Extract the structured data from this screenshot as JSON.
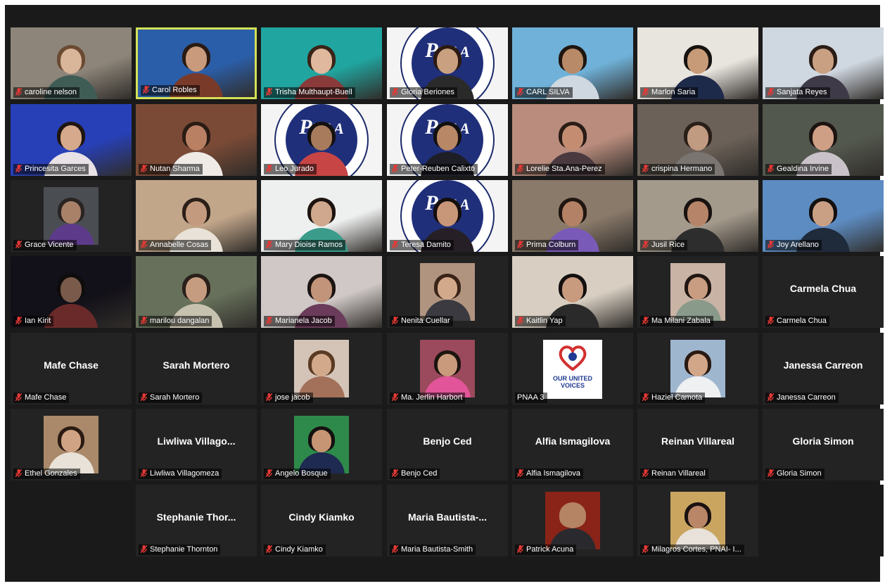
{
  "participants": [
    {
      "name": "caroline nelson",
      "display": "video",
      "bg": "#8d8579",
      "skin": "#d9b59a",
      "hair": "#6b4a32",
      "shirt": "#3f5c55"
    },
    {
      "name": "Carol Robles",
      "display": "video",
      "bg": "#2b5ea8",
      "skin": "#c99a7c",
      "hair": "#2a1a12",
      "shirt": "#7a3a2a",
      "active": true
    },
    {
      "name": "Trisha Multhaupt-Buell",
      "display": "video",
      "bg": "#21a5a0",
      "skin": "#e0b89d",
      "hair": "#3a2418",
      "shirt": "#8a3a3a"
    },
    {
      "name": "Gloria Beriones",
      "display": "pnaa",
      "skin": "#c9a080",
      "hair": "#2a1a12",
      "shirt": "#2a2a2a"
    },
    {
      "name": "CARL SILVA",
      "display": "video",
      "bg": "#6fb1d8",
      "skin": "#b88a68",
      "hair": "#1f1611",
      "shirt": "#cfd8e0"
    },
    {
      "name": "Marlon Saria",
      "display": "video",
      "bg": "#e8e4de",
      "skin": "#c79b78",
      "hair": "#161210",
      "shirt": "#1d2a4a"
    },
    {
      "name": "Sanjata Reyes",
      "display": "video",
      "bg": "#cfd7e0",
      "skin": "#caa083",
      "hair": "#2b1d16",
      "shirt": "#3e3a47"
    },
    {
      "name": "Princesita Garces",
      "display": "video",
      "bg": "#2740b8",
      "skin": "#d6a98c",
      "hair": "#20150f",
      "shirt": "#e8e2e6"
    },
    {
      "name": "Nutan Sharma",
      "display": "video",
      "bg": "#7a4a36",
      "skin": "#b98064",
      "hair": "#2a1c14",
      "shirt": "#efeae6"
    },
    {
      "name": "Leo Jurado",
      "display": "pnaa",
      "skin": "#a77b5c",
      "hair": "#151010",
      "shirt": "#c84545"
    },
    {
      "name": "Peter-Reuben Calixto",
      "display": "pnaa",
      "skin": "#b78766",
      "hair": "#121010",
      "shirt": "#1e1e26"
    },
    {
      "name": "Lorelie Sta.Ana-Perez",
      "display": "video",
      "bg": "#b98c7d",
      "skin": "#c48d72",
      "hair": "#2a1c16",
      "shirt": "#4a3a40"
    },
    {
      "name": "crispina Hermano",
      "display": "video",
      "bg": "#6b6158",
      "skin": "#c19a82",
      "hair": "#2a1e18",
      "shirt": "#7a7570"
    },
    {
      "name": "Gealdina Irvine",
      "display": "video",
      "bg": "#53584e",
      "skin": "#cf9f85",
      "hair": "#1c1410",
      "shirt": "#c9c2c8"
    },
    {
      "name": "Grace Vicente",
      "display": "photo",
      "bg": "#4a4d52",
      "skin": "#a98068",
      "hair": "#2a2422",
      "shirt": "#5d3b8a"
    },
    {
      "name": "Annabelle Cosas",
      "display": "video",
      "bg": "#c2a68a",
      "skin": "#c49a7e",
      "hair": "#2b1f18",
      "shirt": "#e8e2d8"
    },
    {
      "name": "Mary Dioise Ramos",
      "display": "video",
      "bg": "#eef0ef",
      "skin": "#d0a88d",
      "hair": "#1d1410",
      "shirt": "#3c9c8b"
    },
    {
      "name": "Teresa Damito",
      "display": "pnaa",
      "skin": "#c89678",
      "hair": "#140e0c",
      "shirt": "#262026"
    },
    {
      "name": "Prima Colburn",
      "display": "video",
      "bg": "#8a7a6a",
      "skin": "#b38165",
      "hair": "#1f1611",
      "shirt": "#7a5ab8"
    },
    {
      "name": "Jusil Rice",
      "display": "video",
      "bg": "#a49a8c",
      "skin": "#b68569",
      "hair": "#181210",
      "shirt": "#2d2d2d"
    },
    {
      "name": "Joy Arellano",
      "display": "video",
      "bg": "#5d8cc2",
      "skin": "#caa084",
      "hair": "#141010",
      "shirt": "#1f2a3a"
    },
    {
      "name": "Ian Kirit",
      "display": "video",
      "bg": "#121018",
      "skin": "#7a5a4a",
      "hair": "#0f0c0c",
      "shirt": "#6a2a2a"
    },
    {
      "name": "marilou dangalan",
      "display": "video",
      "bg": "#66705a",
      "skin": "#c69c80",
      "hair": "#2a1f1a",
      "shirt": "#c7c2b0"
    },
    {
      "name": "Marianela Jacob",
      "display": "video",
      "bg": "#cfc8c6",
      "skin": "#c2947a",
      "hair": "#1c1412",
      "shirt": "#6a3b5a"
    },
    {
      "name": "Nenita Cuellar",
      "display": "photo",
      "bg": "#b09480",
      "skin": "#d3a98c",
      "hair": "#3a2418",
      "shirt": "#3a3a40"
    },
    {
      "name": "Kaitlin Yap",
      "display": "video",
      "bg": "#d8cfc2",
      "skin": "#c89a7e",
      "hair": "#141010",
      "shirt": "#2a2a2a"
    },
    {
      "name": "Ma Milani Zabala",
      "display": "photo",
      "bg": "#c9b3a5",
      "skin": "#c99d82",
      "hair": "#201612",
      "shirt": "#8a9a8a"
    },
    {
      "name": "Carmela Chua",
      "display": "name",
      "big": "Carmela Chua"
    },
    {
      "name": "Mafe Chase",
      "display": "name",
      "big": "Mafe Chase"
    },
    {
      "name": "Sarah Mortero",
      "display": "name",
      "big": "Sarah Mortero"
    },
    {
      "name": "jose jacob",
      "display": "photo",
      "bg": "#d4c4b8",
      "skin": "#d3a98b",
      "hair": "#5a3a22",
      "shirt": "#a3705a"
    },
    {
      "name": "Ma. Jerlin Harbort",
      "display": "photo",
      "bg": "#9a4a5c",
      "skin": "#c99a7c",
      "hair": "#1d1410",
      "shirt": "#e2559a"
    },
    {
      "name": "PNAA 3",
      "display": "logo",
      "logo": "OUR UNITED VOICES"
    },
    {
      "name": "Haziel Camota",
      "display": "photo",
      "bg": "#9fb6cf",
      "skin": "#d2a689",
      "hair": "#2a1a12",
      "shirt": "#eef0f2"
    },
    {
      "name": "Janessa Carreon",
      "display": "name",
      "big": "Janessa Carreon"
    },
    {
      "name": "Ethel Gonzales",
      "display": "photo",
      "bg": "#a9896a",
      "skin": "#cfa384",
      "hair": "#2a1a12",
      "shirt": "#e9e2d8"
    },
    {
      "name": "Liwliwa Villagomeza",
      "display": "name",
      "big": "Liwliwa  Villago..."
    },
    {
      "name": "Angelo Bosque",
      "display": "photo",
      "bg": "#2e8a4a",
      "skin": "#c69574",
      "hair": "#141010",
      "shirt": "#1f2a52"
    },
    {
      "name": "Benjo Ced",
      "display": "name",
      "big": "Benjo Ced"
    },
    {
      "name": "Alfia Ismagilova",
      "display": "name",
      "big": "Alfia Ismagilova"
    },
    {
      "name": "Reinan Villareal",
      "display": "name",
      "big": "Reinan Villareal"
    },
    {
      "name": "Gloria Simon",
      "display": "name",
      "big": "Gloria Simon"
    },
    {
      "name": "",
      "display": "empty"
    },
    {
      "name": "Stephanie Thornton",
      "display": "name",
      "big": "Stephanie  Thor..."
    },
    {
      "name": "Cindy Kiamko",
      "display": "name",
      "big": "Cindy Kiamko"
    },
    {
      "name": "Maria Bautista-Smith",
      "display": "name",
      "big": "Maria  Bautista-..."
    },
    {
      "name": "Patrick Acuna",
      "display": "photo",
      "bg": "#8a2418",
      "skin": "#b48464",
      "hair": "#b48464",
      "shirt": "#2a2a2e"
    },
    {
      "name": "Milagros Cortes, PNAI- I...",
      "display": "photo",
      "bg": "#c9a560",
      "skin": "#b98668",
      "hair": "#1a1210",
      "shirt": "#e8e2da"
    },
    {
      "name": "",
      "display": "empty"
    }
  ]
}
